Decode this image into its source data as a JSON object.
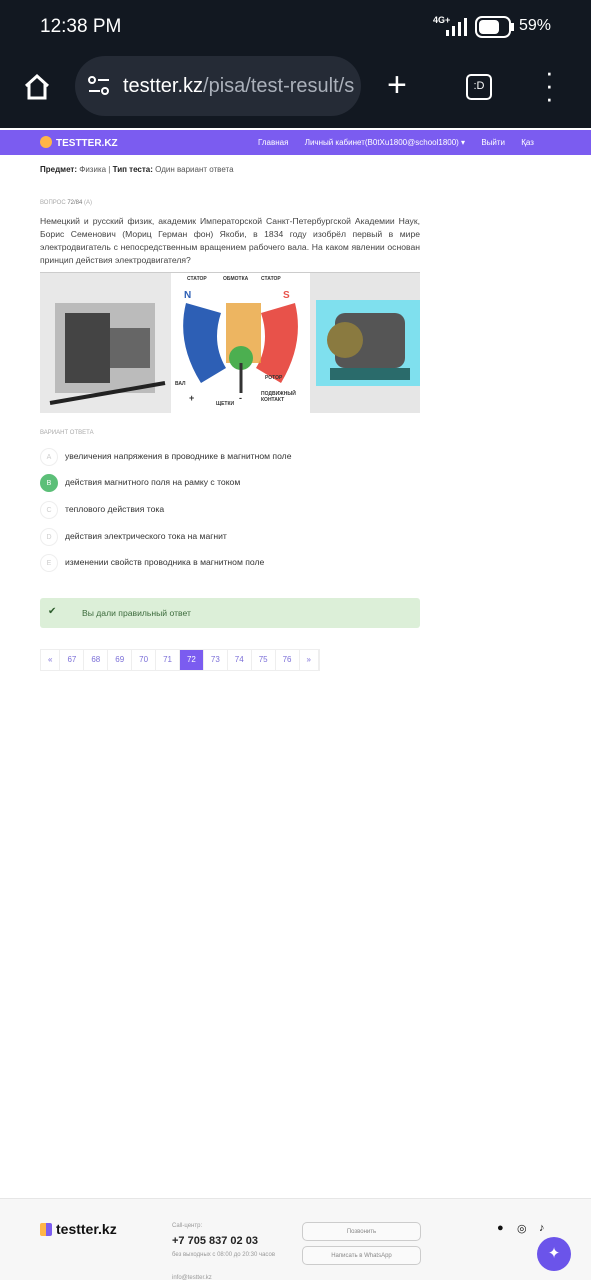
{
  "status_bar": {
    "time": "12:38 PM",
    "network": "4G+",
    "battery": "59%"
  },
  "browser": {
    "url_host": "testter.kz",
    "url_path": "/pisa/test-result/s",
    "tab_count": ":D"
  },
  "nav": {
    "brand": "TESTTER.KZ",
    "links": [
      "Главная",
      "Личный кабинет(B0tXu1800@school1800) ▾",
      "Выйти",
      "Қаз"
    ]
  },
  "meta": {
    "subject_label": "Предмет:",
    "subject": "Физика",
    "sep": "|",
    "type_label": "Тип теста:",
    "type": "Один вариант ответа"
  },
  "question": {
    "prefix": "ВОПРОС",
    "number": "72/84",
    "tag": "(A)",
    "text": "Немецкий и русский физик, академик Императорской Санкт-Петербургской Академии Наук, Борис Семенович (Мориц Герман фон) Якоби, в 1834 году изобрёл первый в мире электродвигатель  с непосредственным вращением рабочего вала. На каком явлении основан принцип действия электродвигателя?"
  },
  "diagram_labels": {
    "stator1": "СТАТОР",
    "winding": "ОБМОТКА",
    "stator2": "СТАТОР",
    "n": "N",
    "s": "S",
    "shaft": "ВАЛ",
    "brushes": "ЩЕТКИ",
    "rotor": "РОТОР",
    "contact": "ПОДВИЖНЫЙ КОНТАКТ",
    "plus": "+",
    "minus": "-"
  },
  "answers": {
    "label": "ВАРИАНТ ОТВЕТА",
    "options": [
      {
        "letter": "A",
        "text": "увеличения напряжения в проводнике в магнитном поле"
      },
      {
        "letter": "B",
        "text": "действия магнитного поля на рамку с током"
      },
      {
        "letter": "C",
        "text": "теплового действия тока"
      },
      {
        "letter": "D",
        "text": "действия электрического тока на магнит"
      },
      {
        "letter": "E",
        "text": "изменении свойств проводника в магнитном поле"
      }
    ],
    "selected": "B"
  },
  "result": {
    "message": "Вы дали правильный ответ"
  },
  "pagination": {
    "prev": "«",
    "pages": [
      "67",
      "68",
      "69",
      "70",
      "71",
      "72",
      "73",
      "74",
      "75",
      "76"
    ],
    "current": "72",
    "next": "»"
  },
  "footer": {
    "brand": "testter.kz",
    "call_label": "Call-центр:",
    "phone": "+7 705 837 02 03",
    "hours": "без выходных с 08:00 до 20:30 часов",
    "email": "info@testter.kz",
    "call_button": "Позвонить",
    "whatsapp_button": "Написать в WhatsApp"
  },
  "colors": {
    "accent": "#7b5cf0",
    "success": "#5cbf78",
    "alert_bg": "#dcefd8"
  }
}
